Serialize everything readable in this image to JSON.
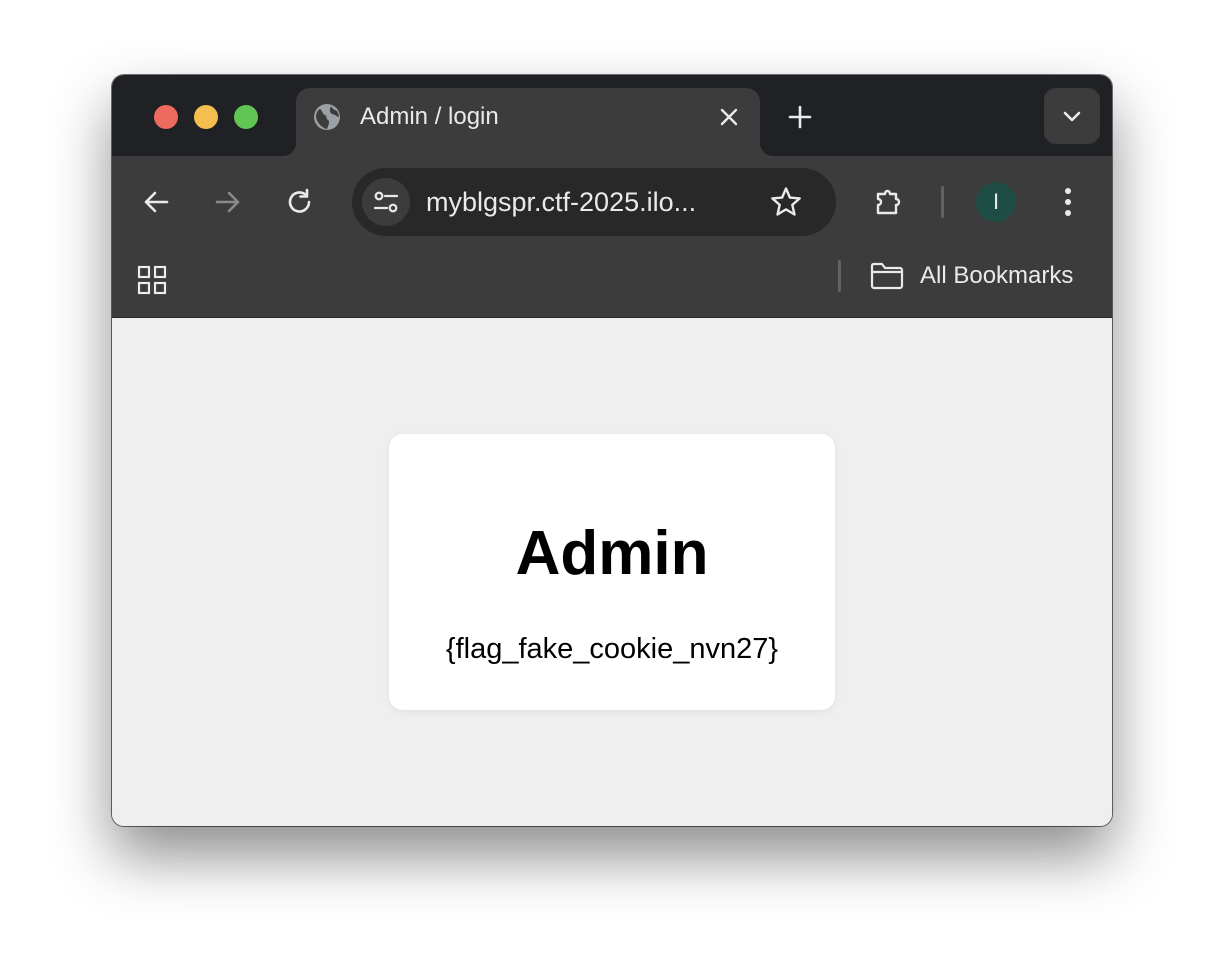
{
  "browser": {
    "tab": {
      "title": "Admin / login",
      "favicon": "globe-icon"
    },
    "url": "myblgspr.ctf-2025.ilo...",
    "profile_initial": "I",
    "bookmarks_bar": {
      "all_bookmarks_label": "All Bookmarks"
    },
    "colors": {
      "titlebar": "#202124",
      "toolbar": "#3c3c3c",
      "omnibox": "#282828",
      "avatar": "#1d4d45",
      "traffic_red": "#ed6a5e",
      "traffic_yellow": "#f5bf4f",
      "traffic_green": "#61c554"
    }
  },
  "page": {
    "heading": "Admin",
    "flag_text": "{flag_fake_cookie_nvn27}",
    "background": "#efefef",
    "card_background": "#ffffff"
  }
}
